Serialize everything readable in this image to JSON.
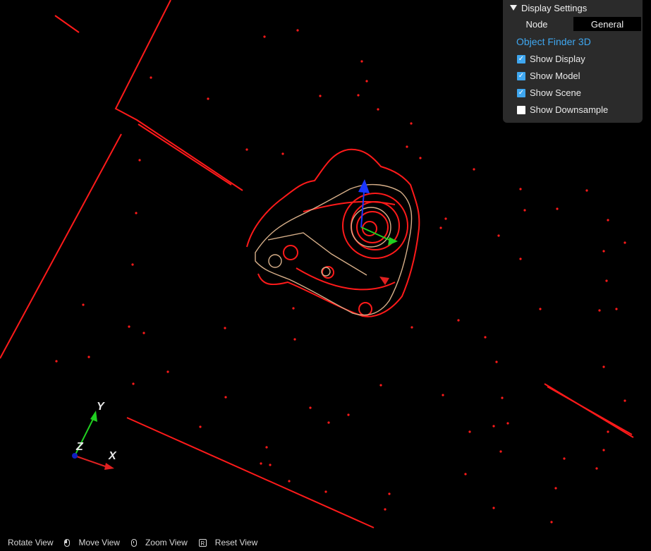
{
  "display_settings": {
    "header_label": "Display Settings",
    "tabs": [
      {
        "label": "Node",
        "active": false
      },
      {
        "label": "General",
        "active": true
      }
    ],
    "section_title": "Object Finder 3D",
    "options": [
      {
        "label": "Show Display",
        "checked": true
      },
      {
        "label": "Show Model",
        "checked": true
      },
      {
        "label": "Show Scene",
        "checked": true
      },
      {
        "label": "Show Downsample",
        "checked": false
      }
    ]
  },
  "axis_indicator": {
    "x_label": "X",
    "y_label": "Y",
    "z_label": "Z"
  },
  "status_bar": {
    "items": [
      {
        "label": "Rotate View",
        "icon": "mouse-left-icon"
      },
      {
        "label": "Move View",
        "icon": "mouse-middle-icon"
      },
      {
        "label": "Zoom View",
        "icon": "keyboard-r-icon",
        "key": "R"
      },
      {
        "label": "Reset View",
        "icon": ""
      }
    ]
  },
  "colors": {
    "background": "#000000",
    "scene_points": "#ff1a1a",
    "model_points": "#d8b08a",
    "panel_bg": "#2b2b2b",
    "accent": "#3fa7f0",
    "axis_x": "#e02020",
    "axis_y": "#20d020",
    "axis_z": "#1020c0"
  }
}
